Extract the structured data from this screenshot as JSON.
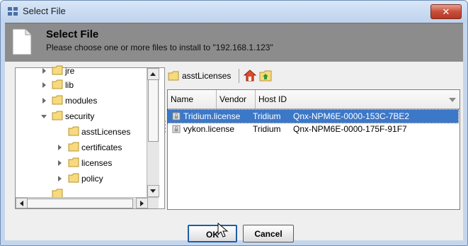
{
  "window": {
    "title": "Select File",
    "close_label": "✕"
  },
  "header": {
    "title": "Select File",
    "subtitle": "Please choose one or more files to install to \"192.168.1.123\""
  },
  "tree": {
    "items": [
      {
        "label": "jre"
      },
      {
        "label": "lib"
      },
      {
        "label": "modules"
      },
      {
        "label": "security"
      },
      {
        "label": "asstLicenses"
      },
      {
        "label": "certificates"
      },
      {
        "label": "licenses"
      },
      {
        "label": "policy"
      }
    ]
  },
  "toolbar": {
    "breadcrumb": "asstLicenses",
    "home_icon": "home-icon",
    "up_icon": "folder-up-icon"
  },
  "table": {
    "columns": [
      "Name",
      "Vendor",
      "Host ID"
    ],
    "rows": [
      {
        "name": "Tridium.license",
        "vendor": "Tridium",
        "host_id": "Qnx-NPM6E-0000-153C-7BE2",
        "selected": true
      },
      {
        "name": "vykon.license",
        "vendor": "Tridium",
        "host_id": "Qnx-NPM6E-0000-175F-91F7",
        "selected": false
      }
    ]
  },
  "buttons": {
    "ok": "OK",
    "cancel": "Cancel"
  },
  "colors": {
    "selection": "#3c78c8",
    "header_band": "#8c8c8c",
    "close_button": "#c74e3a"
  }
}
